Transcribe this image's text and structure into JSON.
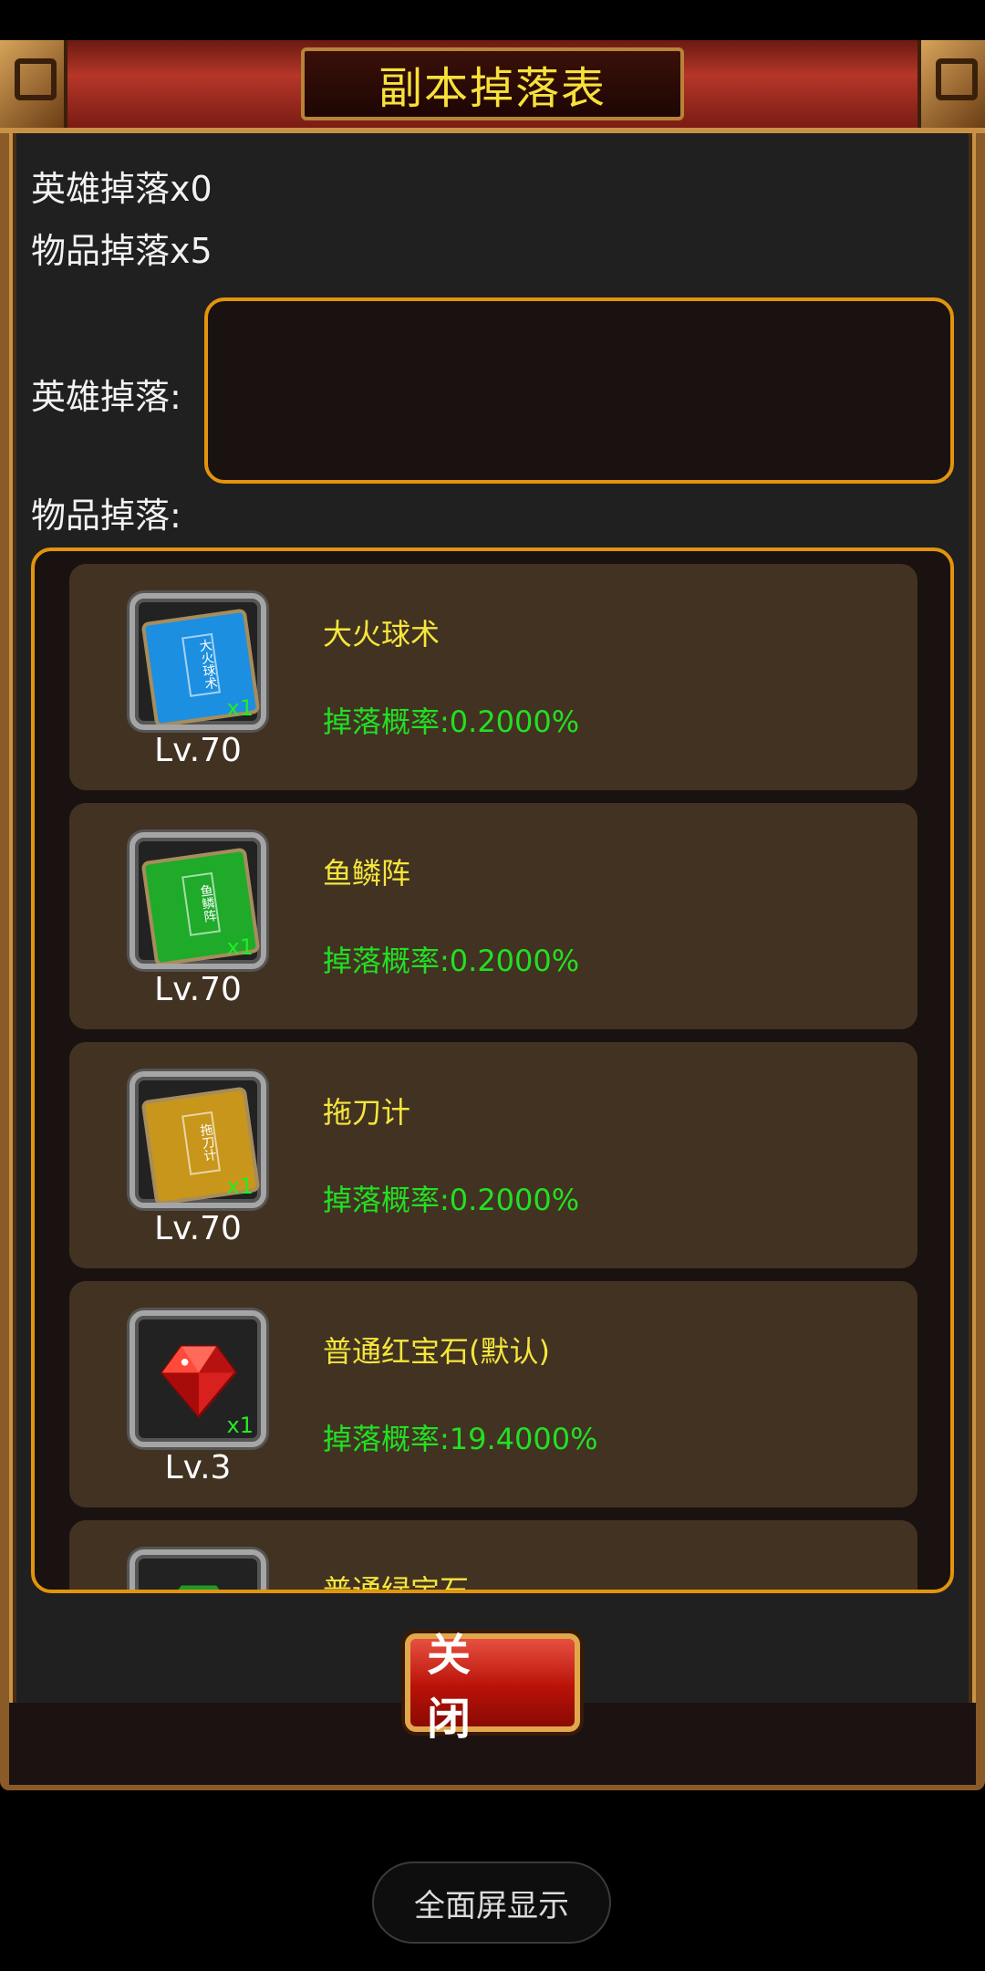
{
  "dialog": {
    "title": "副本掉落表",
    "hero_drop_count": "英雄掉落x0",
    "item_drop_count": "物品掉落x5",
    "hero_drop_label": "英雄掉落:",
    "item_drop_label": "物品掉落:",
    "close_label": "关 闭"
  },
  "items": [
    {
      "name": "大火球术",
      "rate": "掉落概率:0.2000%",
      "level": "Lv.70",
      "qty": "x1",
      "icon": "blue-skill-book-icon",
      "book_text": "大火球术",
      "color": "#1d8fe0"
    },
    {
      "name": "鱼鳞阵",
      "rate": "掉落概率:0.2000%",
      "level": "Lv.70",
      "qty": "x1",
      "icon": "green-skill-book-icon",
      "book_text": "鱼鳞阵",
      "color": "#1faa2a"
    },
    {
      "name": "拖刀计",
      "rate": "掉落概率:0.2000%",
      "level": "Lv.70",
      "qty": "x1",
      "icon": "gold-skill-book-icon",
      "book_text": "拖刀计",
      "color": "#c8961a"
    },
    {
      "name": "普通红宝石(默认)",
      "rate": "掉落概率:19.4000%",
      "level": "Lv.3",
      "qty": "x1",
      "icon": "red-gem-icon",
      "color": "#d8201e"
    },
    {
      "name": "普通绿宝石",
      "icon": "green-gem-icon"
    }
  ],
  "system": {
    "fullscreen_label": "全面屏显示"
  }
}
